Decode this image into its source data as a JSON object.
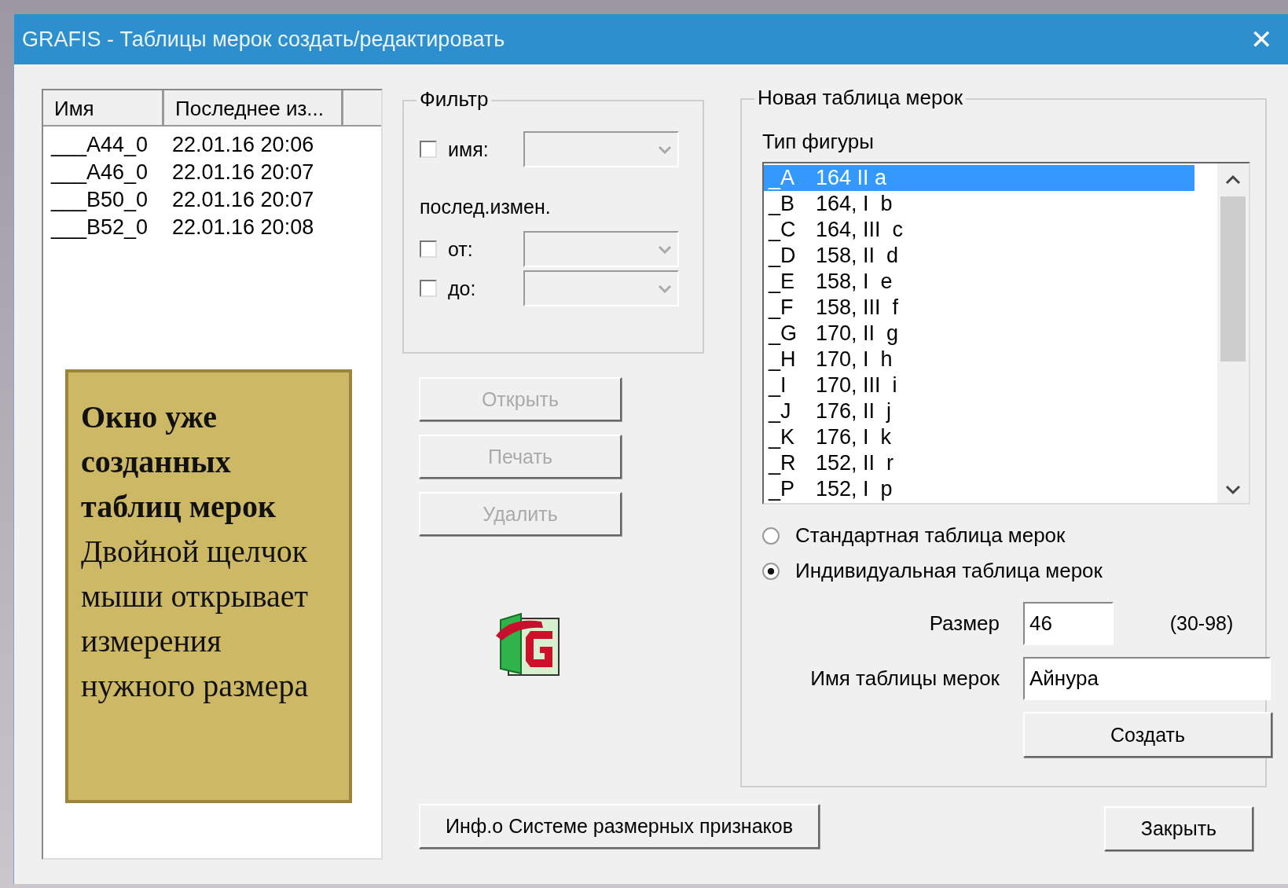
{
  "window": {
    "title": "GRAFIS - Таблицы мерок создать/редактировать",
    "close": "✕"
  },
  "tables": {
    "columns": [
      "Имя",
      "Последнее из..."
    ],
    "rows": [
      {
        "name": "___A44_0",
        "modified": "22.01.16  20:06"
      },
      {
        "name": "___A46_0",
        "modified": "22.01.16  20:07"
      },
      {
        "name": "___B50_0",
        "modified": "22.01.16  20:07"
      },
      {
        "name": "___B52_0",
        "modified": "22.01.16  20:08"
      }
    ]
  },
  "annotation": {
    "text": "**Окно уже созданных таблиц мерок** Двойной щелчок мыши открывает измерения нужного размера"
  },
  "filter": {
    "title": "Фильтр",
    "name_filter": {
      "label": "имя:",
      "checked": false
    },
    "section_label": "послед.измен.",
    "from_filter": {
      "label": "от:",
      "checked": false
    },
    "to_filter": {
      "label": "до:",
      "checked": false
    }
  },
  "actions": [
    {
      "label": "Открыть",
      "disabled": true
    },
    {
      "label": "Печать",
      "disabled": true
    },
    {
      "label": "Удалить",
      "disabled": true
    }
  ],
  "new_table": {
    "title": "Новая таблица мерок",
    "figure_label": "Тип фигуры",
    "figures": [
      {
        "code": "_A",
        "label": "164 II a",
        "selected": true
      },
      {
        "code": "_B",
        "label": "164, I  b",
        "selected": false
      },
      {
        "code": "_C",
        "label": "164, III  c",
        "selected": false
      },
      {
        "code": "_D",
        "label": "158, II  d",
        "selected": false
      },
      {
        "code": "_E",
        "label": "158, I  e",
        "selected": false
      },
      {
        "code": "_F",
        "label": "158, III  f",
        "selected": false
      },
      {
        "code": "_G",
        "label": "170, II  g",
        "selected": false
      },
      {
        "code": "_H",
        "label": "170, I  h",
        "selected": false
      },
      {
        "code": "_I",
        "label": "170, III  i",
        "selected": false
      },
      {
        "code": "_J",
        "label": "176, II  j",
        "selected": false
      },
      {
        "code": "_K",
        "label": "176, I  k",
        "selected": false
      },
      {
        "code": "_R",
        "label": "152, II  r",
        "selected": false
      },
      {
        "code": "_P",
        "label": "152, I  p",
        "selected": false
      }
    ],
    "options": [
      {
        "label": "Стандартная таблица мерок",
        "selected": false
      },
      {
        "label": "Индивидуальная таблица мерок",
        "selected": true
      }
    ],
    "size_label": "Размер",
    "size_value": "46",
    "size_range": "(30-98)",
    "name_label": "Имя таблицы мерок",
    "name_value": "Айнура",
    "create": "Создать"
  },
  "info_button": "Инф.о Системе размерных признаков",
  "close_button": "Закрыть"
}
